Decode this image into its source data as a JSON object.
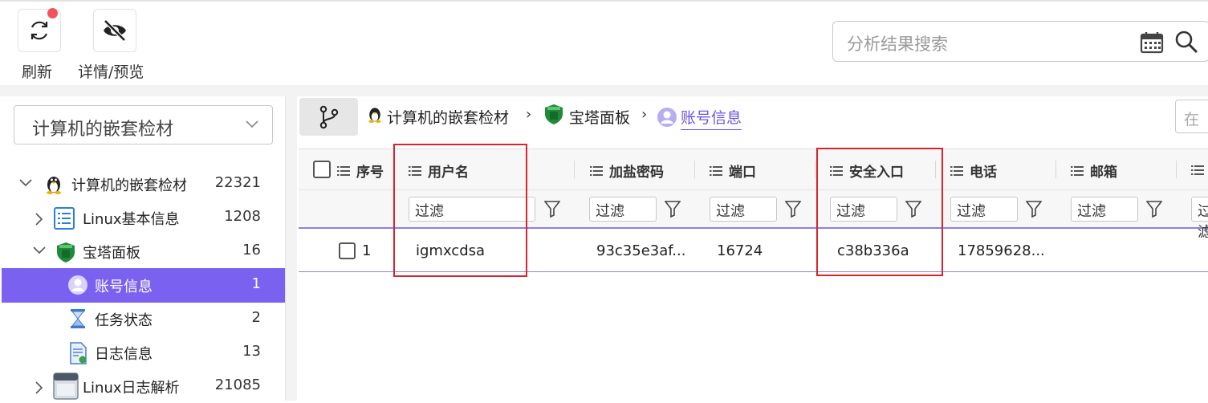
{
  "toolbar": {
    "refresh_label": "刷新",
    "preview_label": "详情/预览",
    "search_placeholder": "分析结果搜索"
  },
  "left_panel": {
    "selected_case": "计算机的嵌套检材",
    "tree": [
      {
        "label": "计算机的嵌套检材",
        "count": "22321",
        "icon": "linux-penguin-icon",
        "expanded": true
      },
      {
        "label": "Linux基本信息",
        "count": "1208",
        "icon": "list-document-icon",
        "expanded": false
      },
      {
        "label": "宝塔面板",
        "count": "16",
        "icon": "baota-shield-icon",
        "expanded": true
      },
      {
        "label": "账号信息",
        "count": "1",
        "icon": "user-avatar-icon",
        "selected": true
      },
      {
        "label": "任务状态",
        "count": "2",
        "icon": "hourglass-icon"
      },
      {
        "label": "日志信息",
        "count": "13",
        "icon": "log-file-icon"
      },
      {
        "label": "Linux日志解析",
        "count": "21085",
        "icon": "log-box-icon",
        "expanded": false
      }
    ],
    "selected_color": "#7b61f0"
  },
  "breadcrumb": {
    "items": [
      "计算机的嵌套检材",
      "宝塔面板",
      "账号信息"
    ],
    "right_input_placeholder": "在"
  },
  "grid": {
    "columns": [
      "序号",
      "用户名",
      "加盐密码",
      "端口",
      "安全入口",
      "电话",
      "邮箱"
    ],
    "filter_placeholder": "过滤",
    "rows": [
      {
        "index": "1",
        "username": "igmxcdsa",
        "salted_password": "93c35e3af...",
        "port": "16724",
        "security_entry": "c38b336a",
        "phone": "17859628...",
        "email": ""
      }
    ],
    "highlighted_columns": [
      "用户名",
      "安全入口"
    ],
    "highlight_color": "#d9232d"
  }
}
